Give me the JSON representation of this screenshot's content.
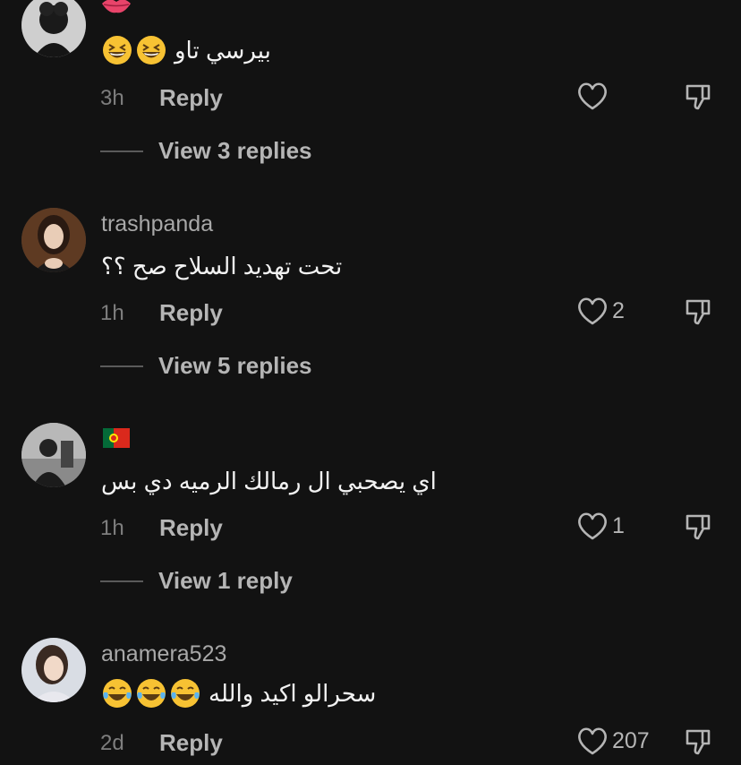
{
  "comments": [
    {
      "username": "",
      "text": "بيرسي تاو",
      "emoji_name": "grinning-squinting-face",
      "time": "3h",
      "reply_label": "Reply",
      "likes": "",
      "view_replies": "View 3 replies",
      "badge": "lips-emoji"
    },
    {
      "username": "trashpanda",
      "text": "تحت تهديد السلاح صح ؟؟",
      "time": "1h",
      "reply_label": "Reply",
      "likes": "2",
      "view_replies": "View 5 replies"
    },
    {
      "username": "",
      "text": "اي يصحبي ال رمالك الرميه دي بس",
      "time": "1h",
      "reply_label": "Reply",
      "likes": "1",
      "view_replies": "View 1 reply",
      "badge": "portugal-flag"
    },
    {
      "username": "anamera523",
      "text": "سحرالو اكيد والله",
      "emoji_name": "face-with-tears-of-joy",
      "time": "2d",
      "reply_label": "Reply",
      "likes": "207"
    }
  ],
  "colors": {
    "background": "#121212",
    "username": "#a8a8a8",
    "secondary": "#b5b5b5",
    "timestamp": "#7e7e7e"
  }
}
